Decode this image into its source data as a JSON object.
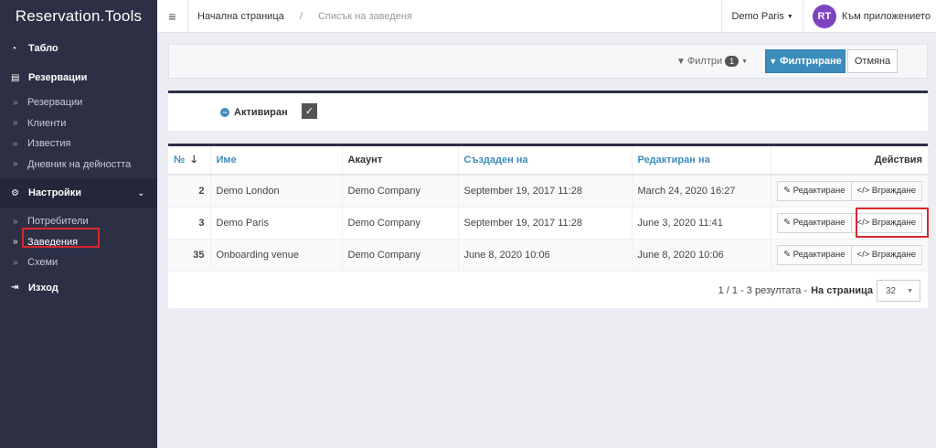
{
  "app": {
    "brand": "Reservation.Tools"
  },
  "sidebar": {
    "dashboard": "Табло",
    "reservations_header": "Резервации",
    "reservation_items": [
      "Резервации",
      "Клиенти",
      "Известия",
      "Дневник на дейността"
    ],
    "settings": "Настройки",
    "settings_items": [
      "Потребители",
      "Заведения",
      "Схеми"
    ],
    "logout": "Изход"
  },
  "topbar": {
    "home": "Начална страница",
    "separator": "/",
    "current": "Списък на заведеня",
    "venue": "Demo Paris",
    "avatar_initials": "RT",
    "app_link": "Към приложението"
  },
  "filterbar": {
    "filters_label": "Филтри",
    "filters_count": "1",
    "filter_button": "Филтриране",
    "cancel_button": "Отмяна"
  },
  "active_filter": {
    "label": "Активиран",
    "checked": "✓"
  },
  "table": {
    "headers": {
      "id": "№",
      "name": "Име",
      "account": "Акаунт",
      "created": "Създаден на",
      "edited": "Редактиран на",
      "actions": "Действия"
    },
    "rows": [
      {
        "id": "2",
        "name": "Demo London",
        "account": "Demo Company",
        "created": "September 19, 2017 11:28",
        "edited": "March 24, 2020 16:27"
      },
      {
        "id": "3",
        "name": "Demo Paris",
        "account": "Demo Company",
        "created": "September 19, 2017 11:28",
        "edited": "June 3, 2020 11:41"
      },
      {
        "id": "35",
        "name": "Onboarding venue",
        "account": "Demo Company",
        "created": "June 8, 2020 10:06",
        "edited": "June 8, 2020 10:06"
      }
    ],
    "edit_label": "Редактиране",
    "embed_label": "Вграждане"
  },
  "pager": {
    "summary": "1 / 1  -  3 резултата  -",
    "per_page_label": "На страница",
    "per_page_value": "32"
  },
  "colors": {
    "sidebar": "#2d2f45",
    "primary": "#3c8dbc",
    "highlight": "#d9262c",
    "avatar": "#7e44c0"
  }
}
